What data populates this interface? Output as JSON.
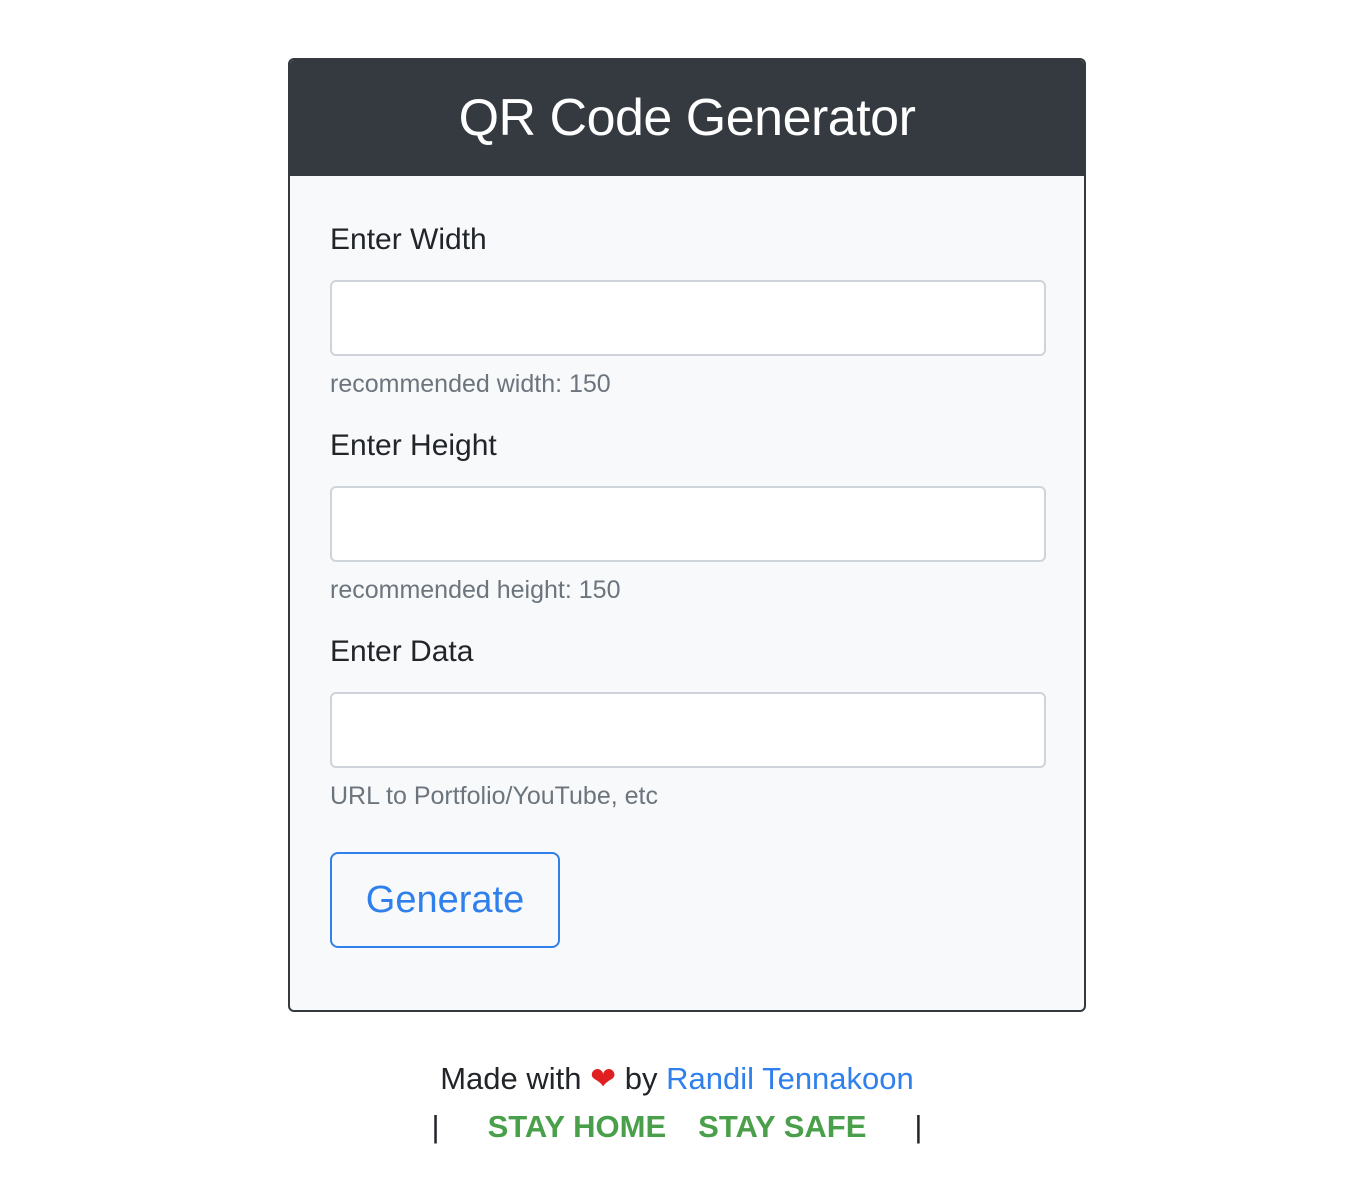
{
  "header": {
    "title": "QR Code Generator"
  },
  "form": {
    "width": {
      "label": "Enter Width",
      "value": "",
      "placeholder": "",
      "help": "recommended width: 150"
    },
    "height": {
      "label": "Enter Height",
      "value": "",
      "placeholder": "",
      "help": "recommended height: 150"
    },
    "data": {
      "label": "Enter Data",
      "value": "",
      "placeholder": "",
      "help": "URL to Portfolio/YouTube, etc"
    },
    "generate_label": "Generate"
  },
  "footer": {
    "made_with": "Made with",
    "heart": "❤",
    "by": "by",
    "author": "Randil Tennakoon",
    "pipe_left": "|",
    "stay_home": "STAY HOME",
    "stay_safe": "STAY SAFE",
    "pipe_right": "|"
  },
  "colors": {
    "header_bg": "#343a40",
    "card_bg": "#f8f9fa",
    "accent_blue": "#2f80ed",
    "help_text": "#6c757d",
    "stay_green": "#4aa04a",
    "heart_red": "#e02020"
  },
  "icons": {
    "heart": "heart-icon"
  }
}
